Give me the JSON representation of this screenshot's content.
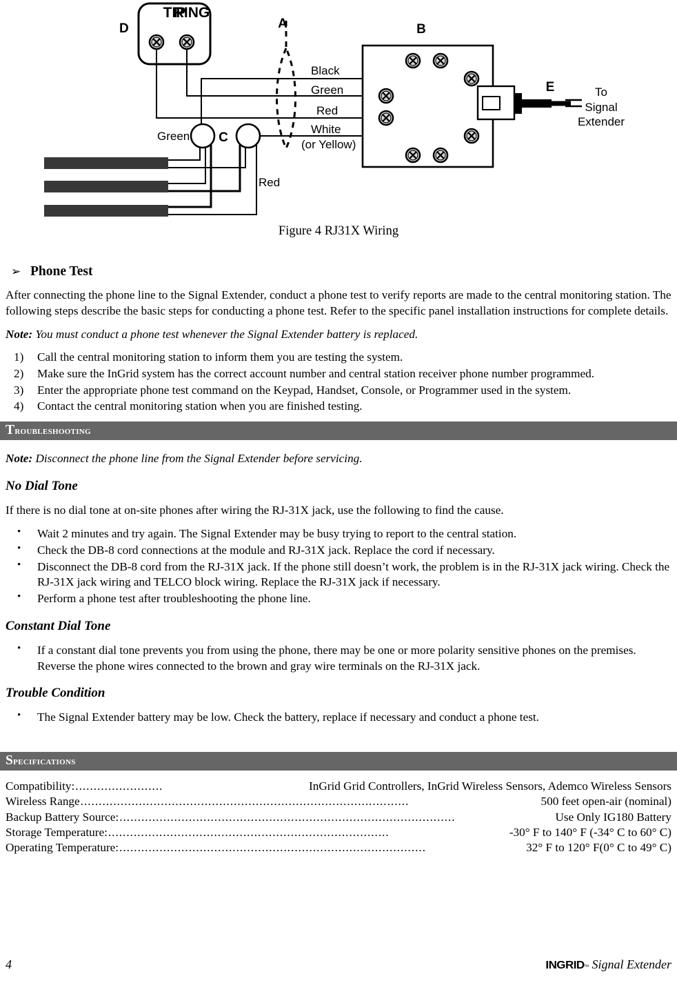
{
  "figure": {
    "caption": "Figure 4 RJ31X Wiring",
    "callouts": {
      "a": "A",
      "b": "B",
      "c": "C",
      "d": "D",
      "e": "E"
    },
    "jack_labels": {
      "tip": "TIP",
      "ring": "RING"
    },
    "wire_labels": {
      "black": "Black",
      "green": "Green",
      "red": "Red",
      "white": "White",
      "white_alt": "(or Yellow)",
      "green_left": "Green",
      "red_lower": "Red"
    },
    "destination": {
      "line1": "To",
      "line2": "Signal",
      "line3": "Extender"
    }
  },
  "phone_test": {
    "heading": "Phone Test",
    "arrow_glyph": "➢",
    "intro": "After connecting the phone line to the Signal Extender, conduct a phone test to verify reports are made to the central monitoring station. The following steps describe the basic steps for conducting a phone test. Refer to the specific panel installation instructions for complete details.",
    "note_label": "Note:",
    "note_text": " You must conduct a phone test whenever the Signal Extender battery is replaced.",
    "steps": [
      {
        "num": "1)",
        "text": "Call the central monitoring station to inform them you are testing the system."
      },
      {
        "num": "2)",
        "text": "Make sure the InGrid system has the correct account number and central station receiver phone number programmed."
      },
      {
        "num": "3)",
        "text": "Enter the appropriate phone test command on the Keypad, Handset, Console, or Programmer used in the system."
      },
      {
        "num": "4)",
        "text": "Contact the central monitoring station when you are finished testing."
      }
    ]
  },
  "troubleshooting": {
    "section_title": "Troubleshooting",
    "note_label": "Note:",
    "note_text": " Disconnect the phone line from the Signal Extender before servicing.",
    "subsections": [
      {
        "title": "No Dial Tone",
        "intro": "If there is no dial tone at on-site phones after wiring the RJ-31X jack, use the following to find the cause.",
        "bullets": [
          "Wait 2 minutes and try again. The Signal Extender may be busy trying to report to the central station.",
          "Check the DB-8 cord connections at the module and RJ-31X jack. Replace the cord if necessary.",
          "Disconnect the DB-8 cord from the RJ-31X jack. If the phone still doesn’t work, the problem is in the RJ-31X jack wiring. Check the RJ-31X jack wiring and TELCO block wiring. Replace the RJ-31X jack if necessary.",
          "Perform a phone test after troubleshooting the phone line."
        ]
      },
      {
        "title": "Constant Dial Tone",
        "intro": "",
        "bullets": [
          "If a constant dial tone prevents you from using the phone, there may be one or more polarity sensitive phones on the premises. Reverse the phone wires connected to the brown and gray wire terminals on the RJ-31X jack."
        ]
      },
      {
        "title": "Trouble Condition",
        "intro": "",
        "bullets": [
          "The Signal Extender battery may be low. Check the battery, replace if necessary and conduct a phone test."
        ]
      }
    ],
    "bullet_glyph": "•"
  },
  "specifications": {
    "section_title": "Specifications",
    "rows": [
      {
        "label": "Compatibility:",
        "leader": "........................",
        "value": " InGrid Grid Controllers, InGrid Wireless Sensors, Ademco Wireless Sensors"
      },
      {
        "label": "Wireless Range",
        "leader": "..........................................................................................",
        "value": "500 feet open-air (nominal)"
      },
      {
        "label": "Backup Battery Source:",
        "leader": "............................................................................................",
        "value": "Use Only IG180 Battery"
      },
      {
        "label": "Storage Temperature:",
        "leader": ".............................................................................",
        "value": " -30° F to 140° F (-34° C to 60° C)"
      },
      {
        "label": "Operating Temperature:",
        "leader": "....................................................................................",
        "value": "32° F to 120° F(0° C to 49° C)"
      }
    ]
  },
  "footer": {
    "page_number": "4",
    "brand": "INGRID",
    "brand_tm": "™",
    "product": "Signal Extender"
  },
  "colors": {
    "section_bar_bg": "#666666",
    "section_bar_text": "#ffffff",
    "telco_block": "#383838",
    "page_bg": "#ffffff",
    "ink": "#000000"
  }
}
